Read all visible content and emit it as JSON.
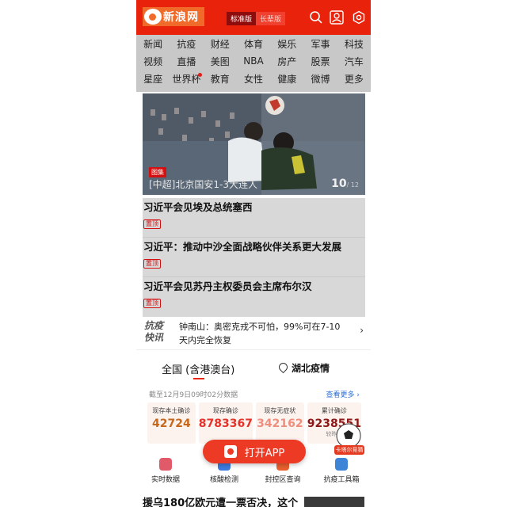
{
  "header": {
    "logo_text": "新浪网",
    "mode_standard": "标准版",
    "mode_elder": "长辈版",
    "accent_color": "#e8220b"
  },
  "nav": {
    "rows": [
      [
        "新闻",
        "抗疫",
        "财经",
        "体育",
        "娱乐",
        "军事",
        "科技"
      ],
      [
        "视频",
        "直播",
        "美图",
        "NBA",
        "房产",
        "股票",
        "汽车"
      ],
      [
        "星座",
        "世界杯",
        "教育",
        "女性",
        "健康",
        "微博",
        "更多"
      ]
    ]
  },
  "hero": {
    "tag": "图集",
    "caption": "[中超]北京国安1-3大连人",
    "page_current": "10",
    "page_total": "/ 12"
  },
  "news": [
    {
      "title": "习近平会见埃及总统塞西",
      "badge": "置顶"
    },
    {
      "title": "习近平：推动中沙全面战略伙伴关系更大发展",
      "badge": "置顶"
    },
    {
      "title": "习近平会见苏丹主权委员会主席布尔汉",
      "badge": "置顶"
    }
  ],
  "flash": {
    "label_line1": "抗疫",
    "label_line2": "快讯",
    "text": "钟南山：奥密克戎不可怕，99%可在7-10天内完全恢复",
    "chevron": "›"
  },
  "epidemic_tabs": {
    "national": "全国 (含港澳台)",
    "hubei": "湖北疫情"
  },
  "asof": "截至12月9日09时02分数据",
  "see_more": "查看更多 ›",
  "stats": [
    {
      "label": "现存本土确诊",
      "value": "42724",
      "sub": "",
      "color": "#c8661a"
    },
    {
      "label": "现存确诊",
      "value": "8783367",
      "sub": "",
      "color": "#e5322a"
    },
    {
      "label": "现存无症状",
      "value": "342162",
      "sub": "",
      "color": "#ef8d7e"
    },
    {
      "label": "累计确诊",
      "value": "9238551",
      "sub": "较昨日",
      "color": "#8e1717"
    }
  ],
  "tools": [
    {
      "label": "实时数据",
      "color": "#e05a6a"
    },
    {
      "label": "核酸检测",
      "color": "#3d7be0"
    },
    {
      "label": "封控区查询",
      "color": "#e9612f"
    },
    {
      "label": "抗疫工具箱",
      "color": "#3b84d6"
    }
  ],
  "open_app": "打开APP",
  "badge_text": "卡塔尔竞猜",
  "bottom_news": "援乌180亿欧元遭一票否决，这个"
}
